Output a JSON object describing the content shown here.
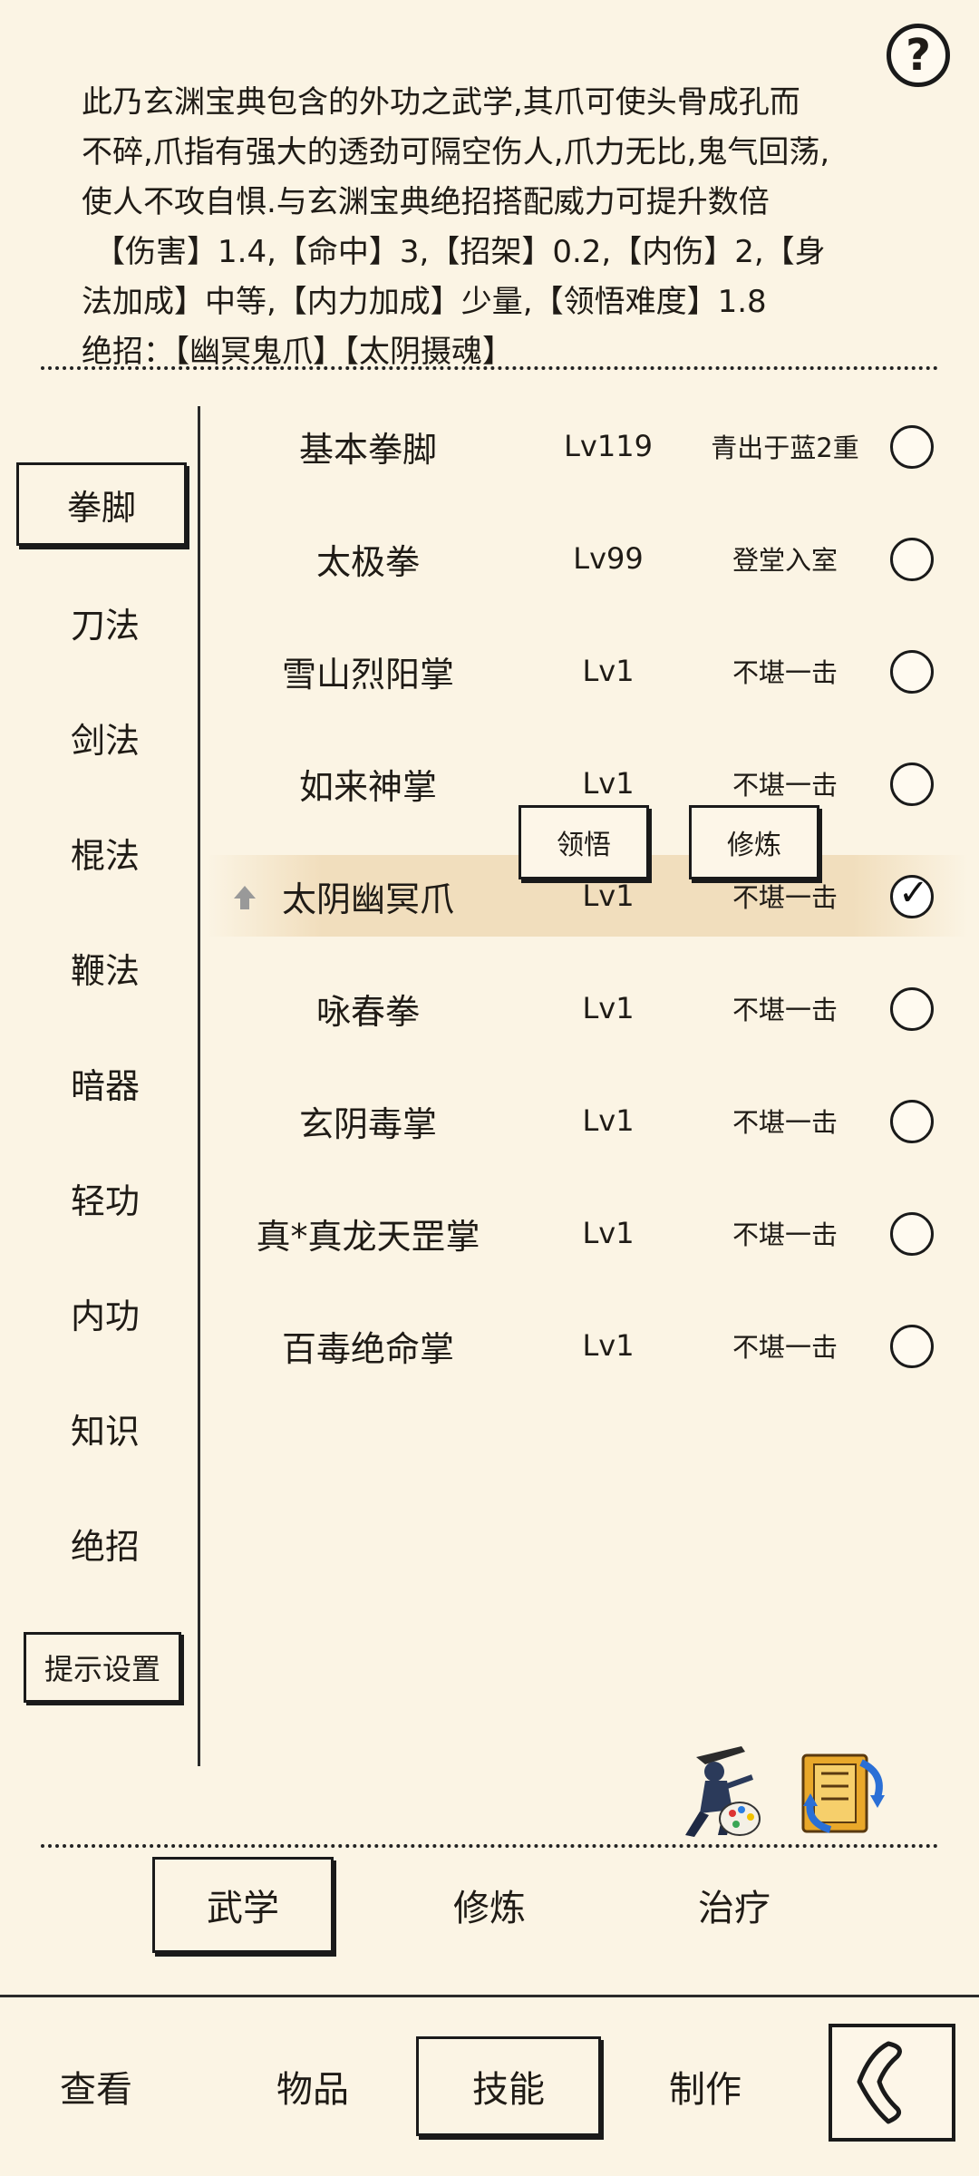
{
  "help": {
    "label": "?"
  },
  "description": {
    "lines": [
      "此乃玄渊宝典包含的外功之武学,其爪可使头骨成孔而",
      "不碎,爪指有强大的透劲可隔空伤人,爪力无比,鬼气回荡,",
      "使人不攻自惧.与玄渊宝典绝招搭配威力可提升数倍",
      "【伤害】1.4,【命中】3,【招架】0.2,【内伤】2,【身",
      "法加成】中等,【内力加成】少量,【领悟难度】1.8",
      "绝招：【幽冥鬼爪】【太阴摄魂】"
    ]
  },
  "categories": [
    {
      "label": "拳脚",
      "active": true
    },
    {
      "label": "刀法"
    },
    {
      "label": "剑法"
    },
    {
      "label": "棍法"
    },
    {
      "label": "鞭法"
    },
    {
      "label": "暗器"
    },
    {
      "label": "轻功"
    },
    {
      "label": "内功"
    },
    {
      "label": "知识"
    },
    {
      "label": "绝招"
    }
  ],
  "tip_settings_label": "提示设置",
  "skills": [
    {
      "name": "基本拳脚",
      "level": "Lv119",
      "rank": "青出于蓝2重",
      "selected": false
    },
    {
      "name": "太极拳",
      "level": "Lv99",
      "rank": "登堂入室",
      "selected": false
    },
    {
      "name": "雪山烈阳掌",
      "level": "Lv1",
      "rank": "不堪一击",
      "selected": false
    },
    {
      "name": "如来神掌",
      "level": "Lv1",
      "rank": "不堪一击",
      "selected": false
    },
    {
      "name": "太阴幽冥爪",
      "level": "Lv1",
      "rank": "不堪一击",
      "selected": true
    },
    {
      "name": "咏春拳",
      "level": "Lv1",
      "rank": "不堪一击",
      "selected": false
    },
    {
      "name": "玄阴毒掌",
      "level": "Lv1",
      "rank": "不堪一击",
      "selected": false
    },
    {
      "name": "真*真龙天罡掌",
      "level": "Lv1",
      "rank": "不堪一击",
      "selected": false
    },
    {
      "name": "百毒绝命掌",
      "level": "Lv1",
      "rank": "不堪一击",
      "selected": false
    }
  ],
  "popup": {
    "comprehend_label": "领悟",
    "practice_label": "修炼"
  },
  "sub_tabs": [
    {
      "label": "武学",
      "active": true
    },
    {
      "label": "修炼"
    },
    {
      "label": "治疗"
    }
  ],
  "bottom_nav": [
    {
      "label": "查看"
    },
    {
      "label": "物品"
    },
    {
      "label": "技能",
      "active": true
    },
    {
      "label": "制作"
    }
  ],
  "icons": {
    "skin": "ninja-palette-icon",
    "swap": "swap-books-icon",
    "back": "back-arrow-icon"
  }
}
